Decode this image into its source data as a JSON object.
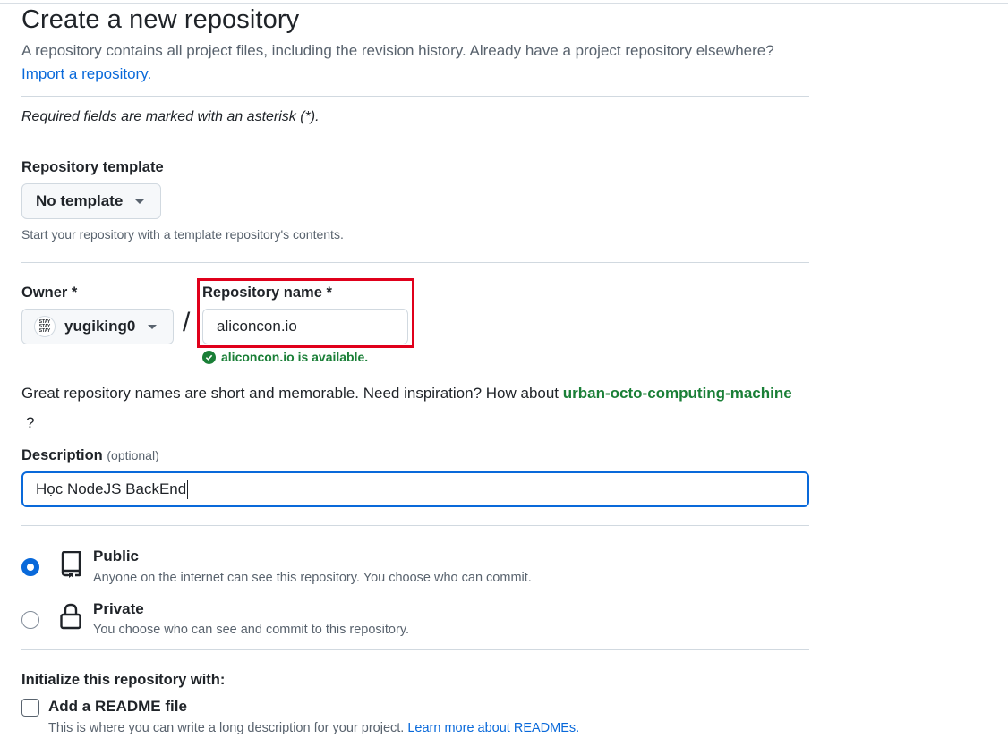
{
  "page": {
    "title": "Create a new repository",
    "intro": "A repository contains all project files, including the revision history. Already have a project repository elsewhere?",
    "import_link": "Import a repository.",
    "required_note": "Required fields are marked with an asterisk (*)."
  },
  "template": {
    "label": "Repository template",
    "selected": "No template",
    "hint": "Start your repository with a template repository's contents."
  },
  "owner": {
    "label": "Owner *",
    "name": "yugiking0",
    "avatar_text": [
      "STAY",
      "STAY",
      "STAY"
    ]
  },
  "repo_name": {
    "label": "Repository name *",
    "value": "aliconcon.io",
    "availability": "aliconcon.io is available."
  },
  "inspiration": {
    "text": "Great repository names are short and memorable. Need inspiration? How about ",
    "suggestion": "urban-octo-computing-machine",
    "question_mark": "?"
  },
  "description": {
    "label": "Description",
    "optional": "(optional)",
    "value": "Học NodeJS BackEnd"
  },
  "visibility": {
    "selected": "public",
    "options": [
      {
        "title": "Public",
        "desc": "Anyone on the internet can see this repository. You choose who can commit."
      },
      {
        "title": "Private",
        "desc": "You choose who can see and commit to this repository."
      }
    ]
  },
  "initialize": {
    "heading": "Initialize this repository with:",
    "readme_label": "Add a README file",
    "readme_checked": false,
    "readme_desc": "This is where you can write a long description for your project. ",
    "readme_link": "Learn more about READMEs."
  },
  "colors": {
    "accent": "#0969da",
    "success": "#1a7f37",
    "highlight_box": "#e0001b"
  }
}
